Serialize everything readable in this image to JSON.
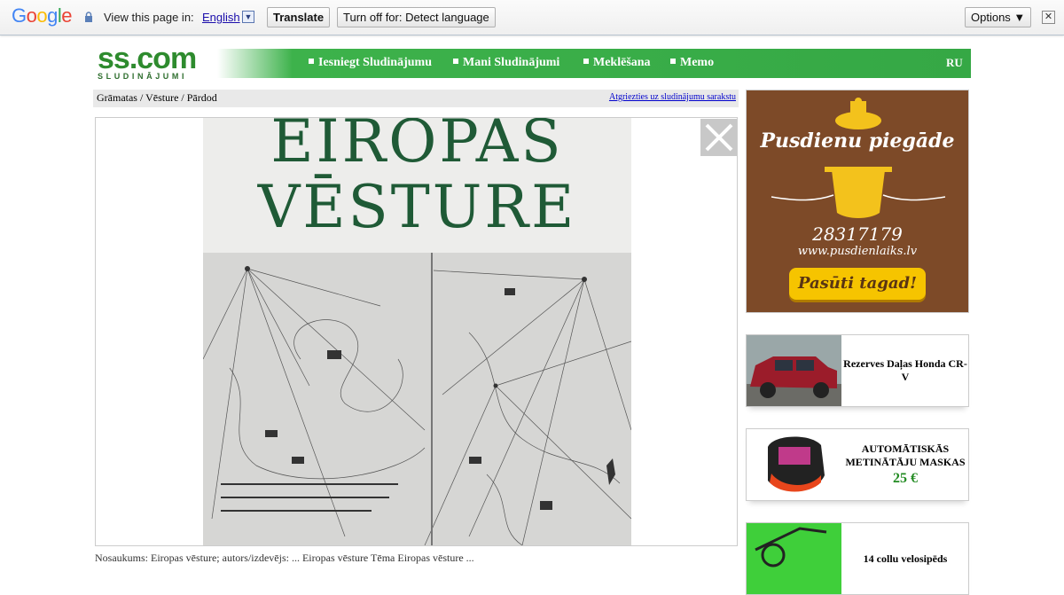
{
  "google_bar": {
    "logo_letters": [
      "G",
      "o",
      "o",
      "g",
      "l",
      "e"
    ],
    "view_text": "View this page in:",
    "language": "English",
    "dropdown_glyph": "▼",
    "translate_btn": "Translate",
    "turn_off_btn": "Turn off for: Detect language",
    "options_btn": "Options ▼",
    "close_glyph": "✕"
  },
  "logo": {
    "main": "ss.com",
    "sub": "SLUDINĀJUMI",
    "color": "#2e8b2e"
  },
  "menu": {
    "items": [
      "Iesniegt Sludinājumu",
      "Mani Sludinājumi",
      "Meklēšana",
      "Memo"
    ],
    "lang": "RU",
    "accent": "#35a845"
  },
  "breadcrumb": {
    "path": "Grāmatas / Vēsture / Pārdod",
    "back_link": "Atgriezties uz sludinājumu sarakstu"
  },
  "photo": {
    "title_line1": "EIROPAS",
    "title_line2": "VĒSTURE",
    "cover_color": "#1f5a36"
  },
  "caption": "Nosaukums: Eiropas vēsture; autors/izdevējs: ... Eiropas vēsture Tēma Eiropas vēsture ...",
  "ads": {
    "banner": {
      "title": "Pusdienu piegāde",
      "phone": "28317179",
      "url": "www.pusdienlaiks.lv",
      "button": "Pasūti tagad!",
      "bg": "#7d4a28"
    },
    "cards": [
      {
        "text": "Rezerves Daļas Honda CR-V",
        "price": ""
      },
      {
        "text": "AUTOMĀTISKĀS METINĀTĀJU MASKAS",
        "price": "25 €"
      },
      {
        "text": "14 collu velosipēds",
        "price": ""
      }
    ]
  }
}
